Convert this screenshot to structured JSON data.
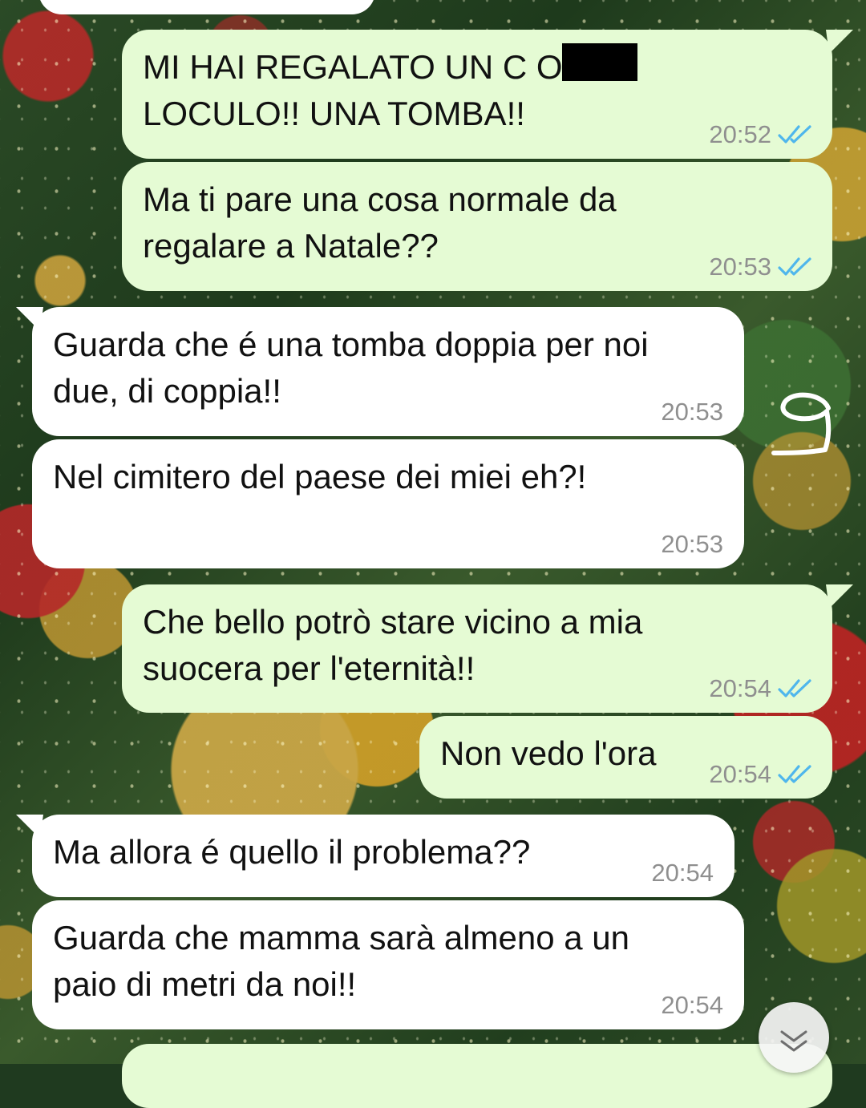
{
  "chat": {
    "messages": [
      {
        "direction": "outgoing",
        "text": "MI HAI REGALATO UN C      O DI\nLOCULO!! UNA TOMBA!!",
        "time": "20:52",
        "status_icon": "double-check-read-icon",
        "note": "partially censored word"
      },
      {
        "direction": "outgoing",
        "text": "Ma ti pare una cosa normale da\nregalare a Natale??",
        "time": "20:53",
        "status_icon": "double-check-read-icon"
      },
      {
        "direction": "incoming",
        "text": "Guarda che é una tomba doppia per noi\ndue, di coppia!!",
        "time": "20:53"
      },
      {
        "direction": "incoming",
        "text": "Nel cimitero del paese dei miei eh?!",
        "time": "20:53"
      },
      {
        "direction": "outgoing",
        "text": "Che bello potrò stare vicino a mia\nsuocera per l'eternità!!",
        "time": "20:54",
        "status_icon": "double-check-read-icon"
      },
      {
        "direction": "outgoing",
        "text": "Non vedo l'ora",
        "time": "20:54",
        "status_icon": "double-check-read-icon"
      },
      {
        "direction": "incoming",
        "text": "Ma allora é quello il problema??",
        "time": "20:54"
      },
      {
        "direction": "incoming",
        "text": "Guarda che mamma sarà almeno a un\npaio di metri da noi!!",
        "time": "20:54"
      }
    ],
    "colors": {
      "outgoing_bubble": "#e5fbd4",
      "incoming_bubble": "#ffffff",
      "read_ticks": "#4fb6ec",
      "timestamp": "#8f8f8f"
    },
    "scroll_down_icon": "double-chevron-down-icon",
    "annotation_icon": "handwritten-g-doodle"
  }
}
